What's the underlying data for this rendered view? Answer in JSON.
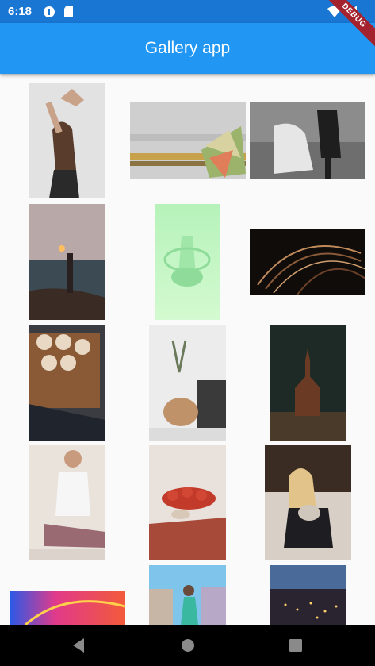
{
  "status_bar": {
    "time": "6:18"
  },
  "app_bar": {
    "title": "Gallery app",
    "debug_banner": "DEBUG"
  },
  "gallery": {
    "items": [
      {
        "name": "woman-arms-raised-photo"
      },
      {
        "name": "abstract-fan-art-photo"
      },
      {
        "name": "couple-dancing-bw-photo"
      },
      {
        "name": "woman-sea-sunset-photo"
      },
      {
        "name": "green-3d-sculpture-photo"
      },
      {
        "name": "dark-swirl-lines-photo"
      },
      {
        "name": "cinnamon-rolls-photo"
      },
      {
        "name": "boho-interior-chair-photo"
      },
      {
        "name": "church-forest-photo"
      },
      {
        "name": "man-stretching-photo"
      },
      {
        "name": "strawberry-tarts-photo"
      },
      {
        "name": "woman-sofa-dog-photo"
      },
      {
        "name": "colorful-gradient-photo"
      },
      {
        "name": "woman-street-photo"
      },
      {
        "name": "city-night-lights-photo"
      }
    ]
  },
  "nav_bar": {
    "back": "back-icon",
    "home": "home-icon",
    "recents": "recents-icon"
  }
}
